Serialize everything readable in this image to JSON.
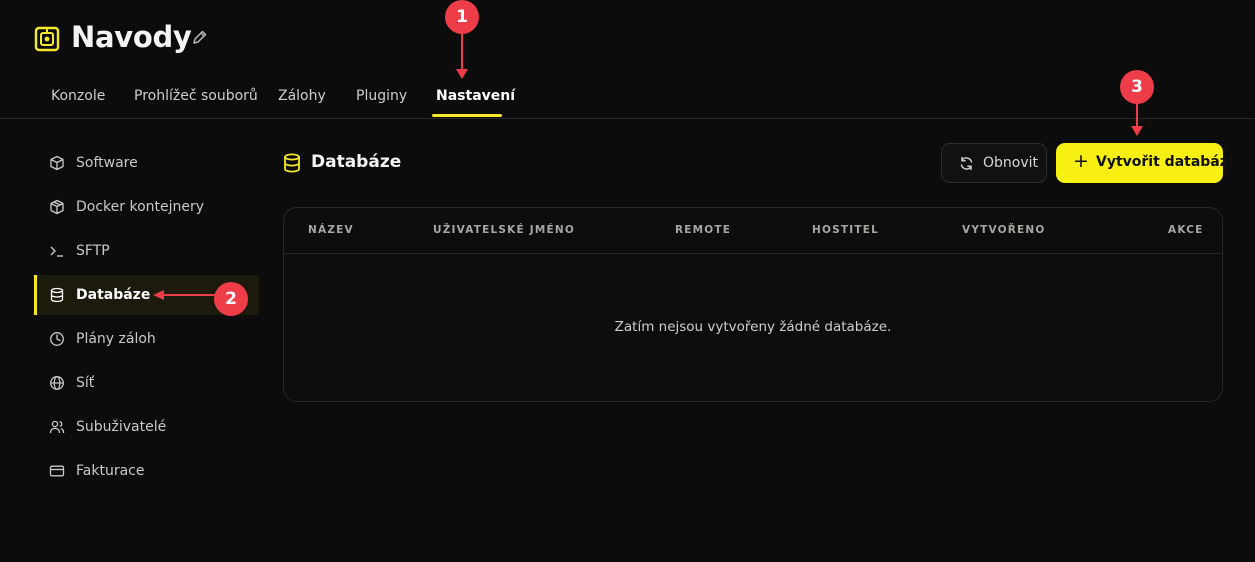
{
  "app": {
    "server_name": "Navody"
  },
  "tabs": [
    {
      "label": "Konzole",
      "active": false
    },
    {
      "label": "Prohlížeč souborů",
      "active": false
    },
    {
      "label": "Zálohy",
      "active": false
    },
    {
      "label": "Pluginy",
      "active": false
    },
    {
      "label": "Nastavení",
      "active": true
    }
  ],
  "sidebar": {
    "items": [
      {
        "label": "Software",
        "icon": "box-icon",
        "active": false
      },
      {
        "label": "Docker kontejnery",
        "icon": "cube-icon",
        "active": false
      },
      {
        "label": "SFTP",
        "icon": "terminal-icon",
        "active": false
      },
      {
        "label": "Databáze",
        "icon": "database-icon",
        "active": true
      },
      {
        "label": "Plány záloh",
        "icon": "clock-icon",
        "active": false
      },
      {
        "label": "Síť",
        "icon": "globe-icon",
        "active": false
      },
      {
        "label": "Subuživatelé",
        "icon": "users-icon",
        "active": false
      },
      {
        "label": "Fakturace",
        "icon": "credit-card-icon",
        "active": false
      }
    ]
  },
  "main": {
    "title": "Databáze",
    "refresh_label": "Obnovit",
    "create_label": "Vytvořit databázi",
    "create_plus": "+",
    "table": {
      "columns": [
        "NÁZEV",
        "UŽIVATELSKÉ JMÉNO",
        "REMOTE",
        "HOSTITEL",
        "VYTVOŘENO",
        "AKCE"
      ],
      "empty_message": "Zatím nejsou vytvořeny žádné databáze."
    }
  },
  "annotations": [
    "1",
    "2",
    "3"
  ],
  "colors": {
    "accent": "#f7f011",
    "background": "#0d0c0c",
    "annotation": "#ee3d48"
  }
}
